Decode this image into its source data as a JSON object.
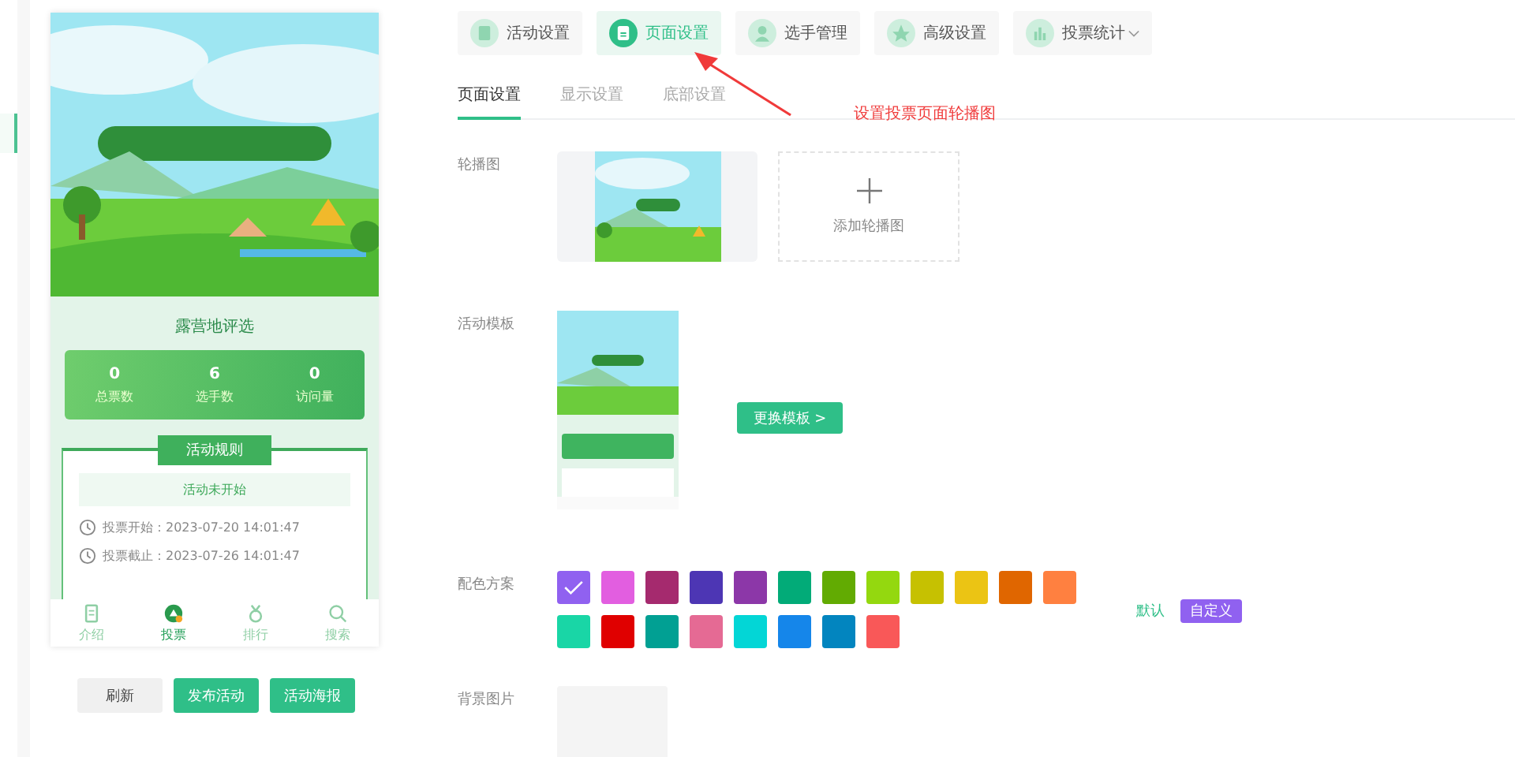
{
  "preview": {
    "title": "露营地评选",
    "stats": [
      {
        "value": "0",
        "label": "总票数"
      },
      {
        "value": "6",
        "label": "选手数"
      },
      {
        "value": "0",
        "label": "访问量"
      }
    ],
    "rules": {
      "heading": "活动规则",
      "status": "活动未开始",
      "lines": [
        {
          "label": "投票开始：",
          "value": "2023-07-20 14:01:47"
        },
        {
          "label": "投票截止：",
          "value": "2023-07-26 14:01:47"
        }
      ]
    },
    "nav": [
      {
        "label": "介绍",
        "kind": "book",
        "selected": false
      },
      {
        "label": "投票",
        "kind": "vote",
        "selected": true
      },
      {
        "label": "排行",
        "kind": "medal",
        "selected": false
      },
      {
        "label": "搜索",
        "kind": "search",
        "selected": false
      }
    ]
  },
  "actions": [
    {
      "label": "刷新",
      "kind": "secondary"
    },
    {
      "label": "发布活动",
      "kind": "primary"
    },
    {
      "label": "活动海报",
      "kind": "primary"
    }
  ],
  "top_tabs": [
    {
      "label": "活动设置",
      "kind": "clipboard",
      "selected": false,
      "dropdown": false
    },
    {
      "label": "页面设置",
      "kind": "page",
      "selected": true,
      "dropdown": false
    },
    {
      "label": "选手管理",
      "kind": "person",
      "selected": false,
      "dropdown": false
    },
    {
      "label": "高级设置",
      "kind": "star",
      "selected": false,
      "dropdown": false
    },
    {
      "label": "投票统计",
      "kind": "chart",
      "selected": false,
      "dropdown": true
    }
  ],
  "sub_tabs": [
    {
      "label": "页面设置",
      "selected": true
    },
    {
      "label": "显示设置",
      "selected": false
    },
    {
      "label": "底部设置",
      "selected": false
    }
  ],
  "annotation": "设置投票页面轮播图",
  "form": {
    "carousel": {
      "label": "轮播图",
      "add_label": "添加轮播图"
    },
    "template": {
      "label": "活动模板",
      "button": "更换模板 >"
    },
    "colors": {
      "label": "配色方案",
      "default": "默认",
      "custom": "自定义",
      "swatches": [
        {
          "color": "#9061f0",
          "selected": true
        },
        {
          "color": "#e25ee0",
          "selected": false
        },
        {
          "color": "#a52a6e",
          "selected": false
        },
        {
          "color": "#4d36b4",
          "selected": false
        },
        {
          "color": "#8c37a8",
          "selected": false
        },
        {
          "color": "#02ab78",
          "selected": false
        },
        {
          "color": "#62ab02",
          "selected": false
        },
        {
          "color": "#94d80f",
          "selected": false
        },
        {
          "color": "#c6c101",
          "selected": false
        },
        {
          "color": "#ebc414",
          "selected": false
        },
        {
          "color": "#e06600",
          "selected": false
        },
        {
          "color": "#ff8040",
          "selected": false
        },
        {
          "color": "#19d6a6",
          "selected": false
        },
        {
          "color": "#e00000",
          "selected": false
        },
        {
          "color": "#01a093",
          "selected": false
        },
        {
          "color": "#e56a94",
          "selected": false
        },
        {
          "color": "#03d6d6",
          "selected": false
        },
        {
          "color": "#1586ea",
          "selected": false
        },
        {
          "color": "#0285bf",
          "selected": false
        },
        {
          "color": "#f95858",
          "selected": false
        }
      ]
    },
    "background": {
      "label": "背景图片"
    }
  }
}
